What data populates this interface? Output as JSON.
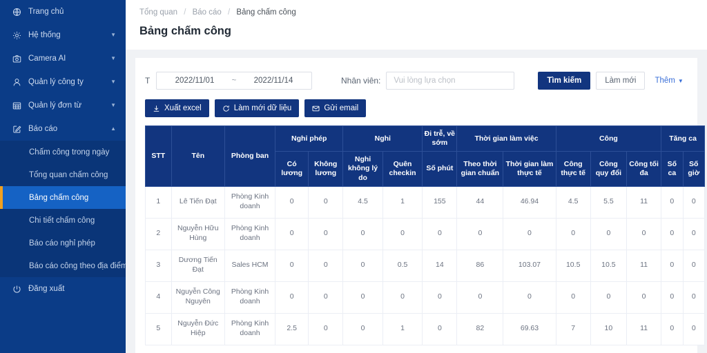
{
  "sidebar": {
    "items": [
      {
        "label": "Trang chủ",
        "icon": "home-icon",
        "caret": false
      },
      {
        "label": "Hệ thống",
        "icon": "gear-icon",
        "caret": true
      },
      {
        "label": "Camera AI",
        "icon": "camera-icon",
        "caret": true
      },
      {
        "label": "Quản lý công ty",
        "icon": "user-icon",
        "caret": true
      },
      {
        "label": "Quản lý đơn từ",
        "icon": "grid-icon",
        "caret": true
      },
      {
        "label": "Báo cáo",
        "icon": "edit-square-icon",
        "caret": true,
        "expanded": true
      }
    ],
    "sub_items": [
      {
        "label": "Chấm công trong ngày",
        "active": false
      },
      {
        "label": "Tổng quan chấm công",
        "active": false
      },
      {
        "label": "Bảng chấm công",
        "active": true
      },
      {
        "label": "Chi tiết chấm công",
        "active": false
      },
      {
        "label": "Báo cáo nghỉ phép",
        "active": false
      },
      {
        "label": "Báo cáo công theo địa điểm",
        "active": false
      }
    ],
    "logout": {
      "label": "Đăng xuất",
      "icon": "logout-icon"
    },
    "accent_color": "#f0a020",
    "bg_color": "#0b3c87",
    "active_color": "#1562c4"
  },
  "breadcrumb": {
    "item1": "Tổng quan",
    "item2": "Báo cáo",
    "current": "Bảng chấm công",
    "separator": "/"
  },
  "page": {
    "title": "Bảng chấm công"
  },
  "filters": {
    "date_label": "T",
    "date_from": "2022/11/01",
    "date_tilde": "~",
    "date_to": "2022/11/14",
    "employee_label": "Nhân viên:",
    "employee_placeholder": "Vui lòng lựa chọn",
    "search_button": "Tìm kiếm",
    "reset_button": "Làm mới",
    "more_link": "Thêm",
    "more_caret": "⌄"
  },
  "actions": [
    {
      "label": "Xuất excel",
      "icon": "download-icon"
    },
    {
      "label": "Làm mới dữ liệu",
      "icon": "refresh-icon"
    },
    {
      "label": "Gửi email",
      "icon": "mail-icon"
    }
  ],
  "table": {
    "group_headers": {
      "stt": "STT",
      "name": "Tên",
      "department": "Phòng ban",
      "leave_paid_group": "Nghỉ phép",
      "absent_group": "Nghỉ",
      "late_group": "Đi trễ, về sớm",
      "worktime_group": "Thời gian làm việc",
      "cong_group": "Công",
      "overtime_group": "Tăng ca"
    },
    "sub_headers": {
      "paid": "Có lương",
      "unpaid": "Không lương",
      "no_reason": "Nghỉ không lý do",
      "forgot_checkin": "Quên checkin",
      "minutes": "Số phút",
      "standard_time": "Theo thời gian chuẩn",
      "actual_time": "Thời gian làm thực tế",
      "actual_cong": "Công thực tế",
      "converted_cong": "Công quy đổi",
      "max_cong": "Công tối đa",
      "shifts": "Số ca",
      "hours": "Số giờ"
    },
    "rows": [
      {
        "stt": "1",
        "name": "Lê Tiến Đạt",
        "department": "Phòng Kinh doanh",
        "paid": "0",
        "unpaid": "0",
        "no_reason": "4.5",
        "forgot_checkin": "1",
        "minutes": "155",
        "standard_time": "44",
        "actual_time": "46.94",
        "actual_cong": "4.5",
        "converted_cong": "5.5",
        "max_cong": "11",
        "shifts": "0",
        "hours": "0"
      },
      {
        "stt": "2",
        "name": "Nguyễn Hữu Hùng",
        "department": "Phòng Kinh doanh",
        "paid": "0",
        "unpaid": "0",
        "no_reason": "0",
        "forgot_checkin": "0",
        "minutes": "0",
        "standard_time": "0",
        "actual_time": "0",
        "actual_cong": "0",
        "converted_cong": "0",
        "max_cong": "0",
        "shifts": "0",
        "hours": "0"
      },
      {
        "stt": "3",
        "name": "Dương Tiến Đạt",
        "department": "Sales HCM",
        "paid": "0",
        "unpaid": "0",
        "no_reason": "0",
        "forgot_checkin": "0.5",
        "minutes": "14",
        "standard_time": "86",
        "actual_time": "103.07",
        "actual_cong": "10.5",
        "converted_cong": "10.5",
        "max_cong": "11",
        "shifts": "0",
        "hours": "0"
      },
      {
        "stt": "4",
        "name": "Nguyễn Công Nguyên",
        "department": "Phòng Kinh doanh",
        "paid": "0",
        "unpaid": "0",
        "no_reason": "0",
        "forgot_checkin": "0",
        "minutes": "0",
        "standard_time": "0",
        "actual_time": "0",
        "actual_cong": "0",
        "converted_cong": "0",
        "max_cong": "0",
        "shifts": "0",
        "hours": "0"
      },
      {
        "stt": "5",
        "name": "Nguyễn Đức Hiệp",
        "department": "Phòng Kinh doanh",
        "paid": "2.5",
        "unpaid": "0",
        "no_reason": "0",
        "forgot_checkin": "1",
        "minutes": "0",
        "standard_time": "82",
        "actual_time": "69.63",
        "actual_cong": "7",
        "converted_cong": "10",
        "max_cong": "11",
        "shifts": "0",
        "hours": "0"
      }
    ]
  }
}
